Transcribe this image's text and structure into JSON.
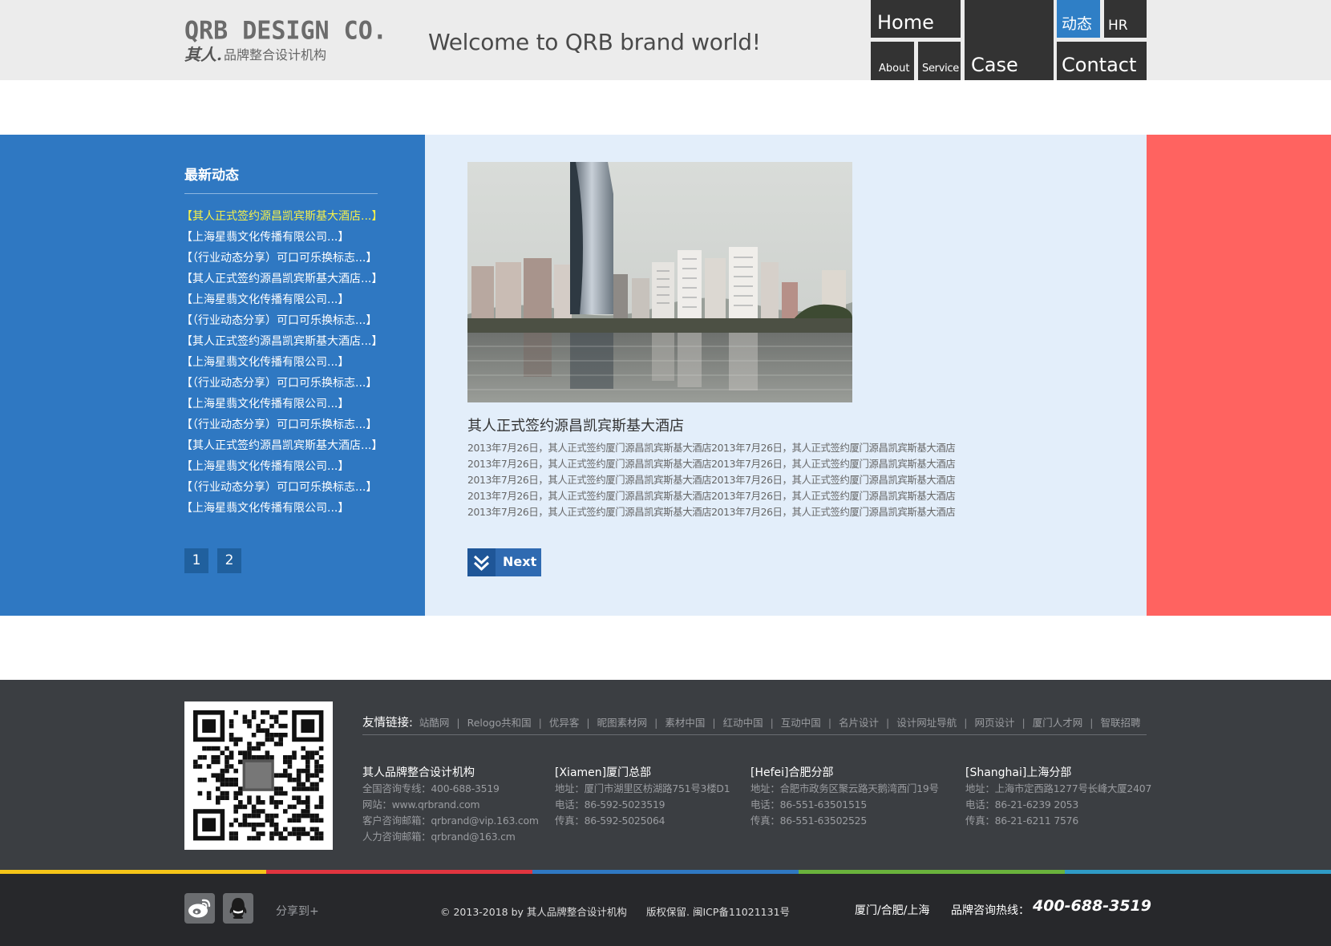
{
  "header": {
    "logo_en": "QRB DESIGN CO.",
    "logo_mark": "其人.",
    "logo_cn": "品牌整合设计机构",
    "welcome": "Welcome to QRB brand world!",
    "nav": {
      "home": "Home",
      "about": "About",
      "service": "Service",
      "case": "Case",
      "news": "动态",
      "hr": "HR",
      "contact": "Contact"
    },
    "active_nav": "动态",
    "active_color": "#2f7fc6"
  },
  "sidebar": {
    "title": "最新动态",
    "items": [
      {
        "label": "【其人正式签约源昌凯宾斯基大酒店...】",
        "active": true
      },
      {
        "label": "【上海星翡文化传播有限公司...】"
      },
      {
        "label": "【（行业动态分享）可口可乐换标志...】"
      },
      {
        "label": "【其人正式签约源昌凯宾斯基大酒店...】"
      },
      {
        "label": "【上海星翡文化传播有限公司...】"
      },
      {
        "label": "【（行业动态分享）可口可乐换标志...】"
      },
      {
        "label": "【其人正式签约源昌凯宾斯基大酒店...】"
      },
      {
        "label": "【上海星翡文化传播有限公司...】"
      },
      {
        "label": "【（行业动态分享）可口可乐换标志...】"
      },
      {
        "label": "【上海星翡文化传播有限公司...】"
      },
      {
        "label": "【（行业动态分享）可口可乐换标志...】"
      },
      {
        "label": "【其人正式签约源昌凯宾斯基大酒店...】"
      },
      {
        "label": "【上海星翡文化传播有限公司...】"
      },
      {
        "label": "【（行业动态分享）可口可乐换标志...】"
      },
      {
        "label": "【上海星翡文化传播有限公司...】"
      }
    ],
    "pages": [
      "1",
      "2"
    ]
  },
  "article": {
    "title": "其人正式签约源昌凯宾斯基大酒店",
    "lines": [
      "2013年7月26日，其人正式签约厦门源昌凯宾斯基大酒店2013年7月26日，其人正式签约厦门源昌凯宾斯基大酒店",
      "2013年7月26日，其人正式签约厦门源昌凯宾斯基大酒店2013年7月26日，其人正式签约厦门源昌凯宾斯基大酒店",
      "2013年7月26日，其人正式签约厦门源昌凯宾斯基大酒店2013年7月26日，其人正式签约厦门源昌凯宾斯基大酒店",
      "2013年7月26日，其人正式签约厦门源昌凯宾斯基大酒店2013年7月26日，其人正式签约厦门源昌凯宾斯基大酒店",
      "2013年7月26日，其人正式签约厦门源昌凯宾斯基大酒店2013年7月26日，其人正式签约厦门源昌凯宾斯基大酒店"
    ],
    "next_label": "Next"
  },
  "colors": {
    "sidebar_bg": "#2f78c2",
    "content_bg": "#e3eefa",
    "accent_right": "#ff6360",
    "footer_bg": "#3b3e42",
    "bottom_bg": "#27282b",
    "active_link": "#f7f14a",
    "strip": [
      "#f5c518",
      "#e0353f",
      "#2f78c2",
      "#6ab23c",
      "#2f9bc6"
    ]
  },
  "footer": {
    "links_label": "友情链接:",
    "links": [
      "站酷网",
      "Relogo共和国",
      "优异客",
      "昵图素材网",
      "素材中国",
      "红动中国",
      "互动中国",
      "名片设计",
      "设计网址导航",
      "网页设计",
      "厦门人才网",
      "智联招聘"
    ],
    "company": {
      "title": "其人品牌整合设计机构",
      "lines": [
        "全国咨询专线：400-688-3519",
        "网站：www.qrbrand.com",
        "客户咨询邮箱：qrbrand@vip.163.com",
        "人力咨询邮箱：qrbrand@163.cm"
      ]
    },
    "xiamen": {
      "title": "[Xiamen]厦门总部",
      "lines": [
        "地址：厦门市湖里区枋湖路751号3楼D1",
        "电话：86-592-5023519",
        "传真：86-592-5025064"
      ]
    },
    "hefei": {
      "title": "[Hefei]合肥分部",
      "lines": [
        "地址：合肥市政务区聚云路天鹅湾西门19号",
        "电话：86-551-63501515",
        "传真：86-551-63502525"
      ]
    },
    "shanghai": {
      "title": "[Shanghai]上海分部",
      "lines": [
        "地址：上海市定西路1277号长峰大厦2407",
        "电话：86-21-6239 2053",
        "传真：86-21-6211 7576"
      ]
    }
  },
  "bottom": {
    "share_label": "分享到+",
    "copyright": "© 2013-2018 by 其人品牌整合设计机构",
    "icp": "版权保留. 闽ICP备11021131号",
    "cities": "厦门/合肥/上海",
    "hotline_label": "品牌咨询热线：",
    "hotline_number": "400-688-3519"
  },
  "icons": {
    "social": [
      "weibo-icon",
      "qq-icon"
    ],
    "next": "chevron-double-down-icon",
    "qr": "qr-code-icon"
  }
}
